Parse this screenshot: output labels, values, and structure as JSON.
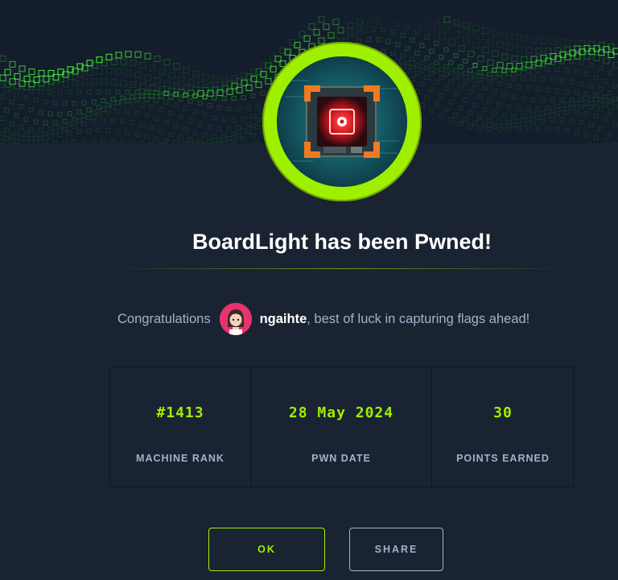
{
  "modal": {
    "title": "BoardLight has been Pwned!",
    "congrats_prefix": "Congratulations",
    "username": "ngaihte",
    "congrats_suffix": ", best of luck in capturing flags ahead!"
  },
  "stats": [
    {
      "value": "#1413",
      "label": "MACHINE RANK"
    },
    {
      "value": "28 May 2024",
      "label": "PWN DATE"
    },
    {
      "value": "30",
      "label": "POINTS EARNED"
    }
  ],
  "buttons": {
    "ok": "OK",
    "share": "SHARE"
  },
  "colors": {
    "background": "#1a2332",
    "accent": "#9fef00",
    "muted_text": "#a4b1cd",
    "avatar_bg": "#e8336f"
  },
  "icons": [
    "machine-badge-icon",
    "user-avatar"
  ]
}
